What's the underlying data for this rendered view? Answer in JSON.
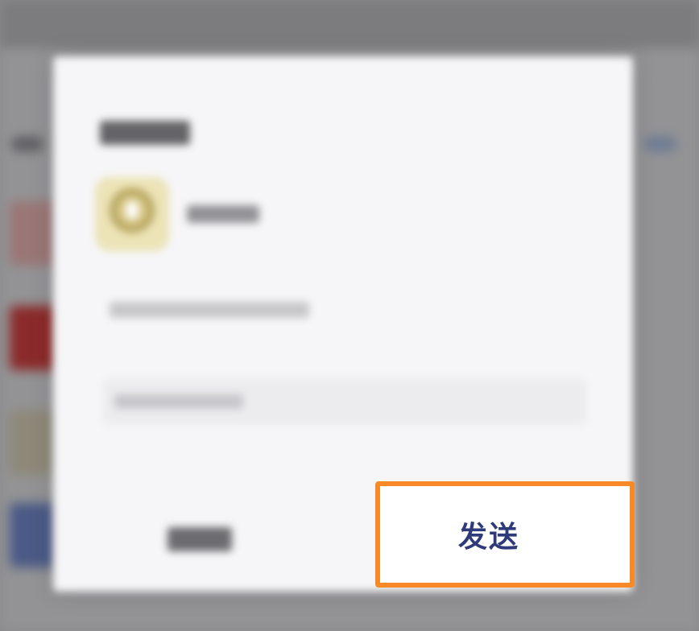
{
  "dialog": {
    "send_label": "发送"
  },
  "colors": {
    "highlight": "#f78a26",
    "send_text": "#2f3a7a",
    "dialog_bg": "#f6f6f8",
    "overlay": "#8a8a8c"
  },
  "icons": {
    "avatar": "user-avatar"
  }
}
